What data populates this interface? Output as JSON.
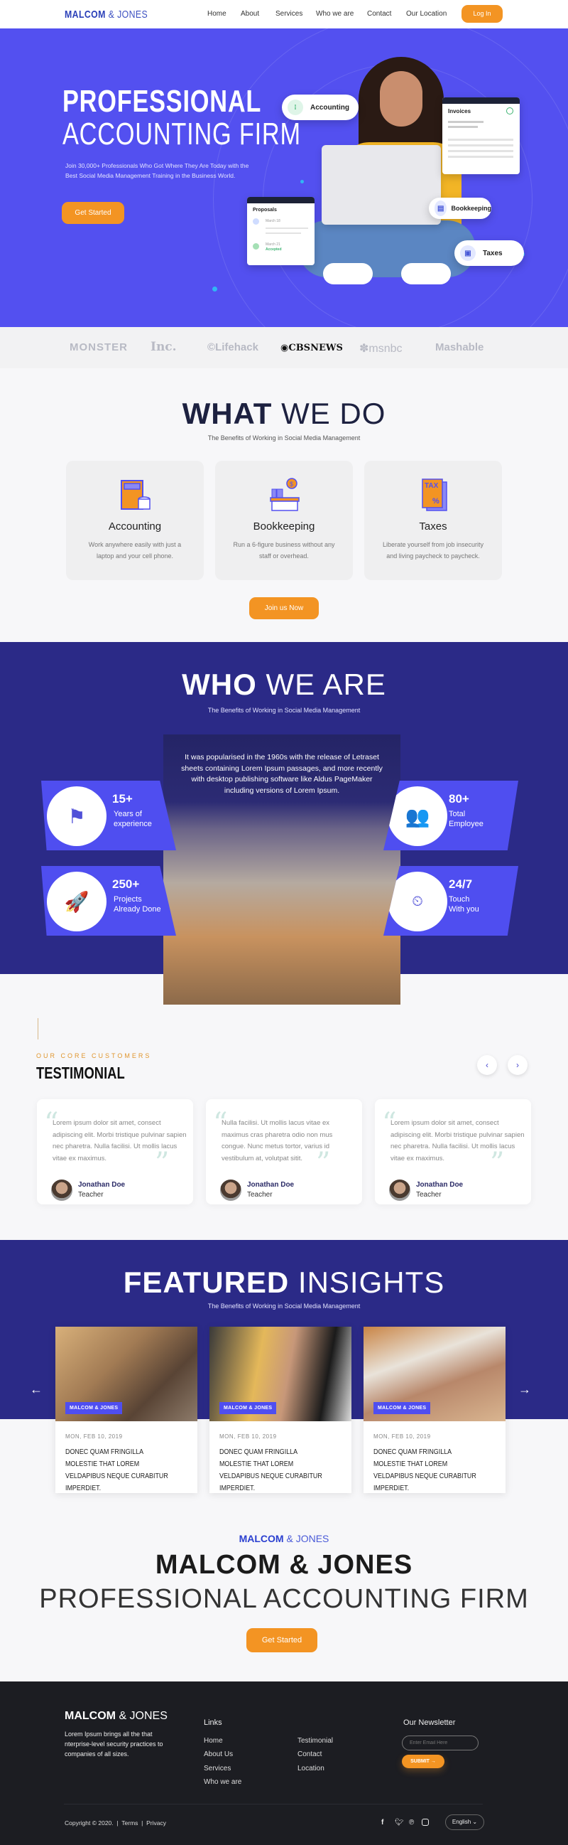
{
  "header": {
    "logo_bold": "MALCOM",
    "logo_light": "& JONES",
    "nav": [
      "Home",
      "About",
      "Services",
      "Who we are",
      "Contact",
      "Our Location"
    ],
    "login_label": "Log In"
  },
  "hero": {
    "title_bold": "PROFESSIONAL",
    "title_light": "ACCOUNTING FIRM",
    "subtitle": "Join 30,000+ Professionals Who Got Where They Are Today with the Best Social Media Management Training in the Business World.",
    "cta_label": "Get Started",
    "pills": [
      "Accounting",
      "Bookkeeping",
      "Taxes"
    ],
    "invoices_title": "Invoices",
    "proposals_title": "Proposals",
    "proposal_date1": "March 18",
    "proposal_date2": "March 21",
    "proposal_status": "Accepted"
  },
  "press_logos": [
    "MONSTER",
    "Inc.",
    "Lifehack",
    "CBSNEWS",
    "msnbc",
    "Mashable"
  ],
  "what_we_do": {
    "title_bold": "WHAT",
    "title_light": "WE DO",
    "subtitle": "The Benefits of Working in Social Media Management",
    "services": [
      {
        "title": "Accounting",
        "desc": "Work anywhere easily with just a laptop and your cell phone.",
        "icon": "calculator-icon"
      },
      {
        "title": "Bookkeeping",
        "desc": "Run a 6-figure business without any staff or overhead.",
        "icon": "bookkeeper-desk-icon"
      },
      {
        "title": "Taxes",
        "desc": "Liberate yourself from job insecurity and living paycheck to paycheck.",
        "icon": "tax-document-icon"
      }
    ],
    "cta_label": "Join us Now"
  },
  "who_we_are": {
    "title_bold": "WHO",
    "title_light": "WE ARE",
    "subtitle": "The Benefits of Working in Social Media Management",
    "body": "It was popularised in the 1960s with the release of Letraset sheets containing Lorem Ipsum passages, and more recently with desktop publishing software like Aldus PageMaker including versions of Lorem Ipsum.",
    "stats": [
      {
        "value": "15+",
        "label1": "Years of",
        "label2": "experience",
        "icon": "team-flag-icon"
      },
      {
        "value": "80+",
        "label1": "Total",
        "label2": "Employee",
        "icon": "group-icon"
      },
      {
        "value": "250+",
        "label1": "Projects",
        "label2": "Already Done",
        "icon": "rocket-icon"
      },
      {
        "value": "24/7",
        "label1": "Touch",
        "label2": "With you",
        "icon": "clock-24-icon"
      }
    ]
  },
  "testimonial": {
    "eyebrow": "OUR CORE CUSTOMERS",
    "title": "TESTIMONIAL",
    "items": [
      {
        "text": "Lorem ipsum dolor sit amet, consect adipiscing elit. Morbi tristique pulvinar sapien nec pharetra. Nulla facilisi. Ut mollis lacus vitae ex maximus.",
        "name": "Jonathan Doe",
        "role": "Teacher"
      },
      {
        "text": "Nulla facilisi. Ut mollis lacus vitae ex maximus cras pharetra odio non mus congue. Nunc metus tortor, varius id vestibulum at, volutpat sitit.",
        "name": "Jonathan Doe",
        "role": "Teacher"
      },
      {
        "text": "Lorem ipsum dolor sit amet, consect adipiscing elit. Morbi tristique pulvinar sapien nec pharetra. Nulla facilisi. Ut mollis lacus vitae ex maximus.",
        "name": "Jonathan Doe",
        "role": "Teacher"
      }
    ]
  },
  "insights": {
    "title_bold": "FEATURED",
    "title_light": "INSIGHTS",
    "subtitle": "The Benefits of Working in Social Media Management",
    "posts": [
      {
        "tag": "MALCOM & JONES",
        "date": "MON, FEB 10, 2019",
        "title": "DONEC QUAM FRINGILLA MOLESTIE THAT LOREM VELDAPIBUS NEQUE CURABITUR IMPERDIET."
      },
      {
        "tag": "MALCOM & JONES",
        "date": "MON, FEB 10, 2019",
        "title": "DONEC QUAM FRINGILLA MOLESTIE THAT LOREM VELDAPIBUS NEQUE CURABITUR IMPERDIET."
      },
      {
        "tag": "MALCOM & JONES",
        "date": "MON, FEB 10, 2019",
        "title": "DONEC QUAM FRINGILLA MOLESTIE THAT LOREM VELDAPIBUS NEQUE CURABITUR IMPERDIET."
      }
    ]
  },
  "cta": {
    "brand_bold": "MALCOM",
    "brand_light": "& JONES",
    "title": "MALCOM & JONES",
    "subtitle": "PROFESSIONAL ACCOUNTING FIRM",
    "button": "Get Started"
  },
  "footer": {
    "logo_bold": "MALCOM",
    "logo_light": "& JONES",
    "about": "Lorem Ipsum brings all the that nterprise-level security practices to companies of all sizes.",
    "links_title": "Links",
    "links_col1": [
      "Home",
      "About Us",
      "Services",
      "Who we are"
    ],
    "links_col2": [
      "Testimonial",
      "Contact",
      "Location"
    ],
    "newsletter_title": "Our Newsletter",
    "email_placeholder": "Enter Email Here",
    "submit_label": "SUBMIT",
    "copyright": "Copyright © 2020.",
    "terms": "Terms",
    "privacy": "Privacy",
    "language": "English"
  },
  "colors": {
    "primary": "#5350f0",
    "navy": "#2b2a87",
    "accent": "#f39423",
    "footer_bg": "#1c1d22"
  }
}
